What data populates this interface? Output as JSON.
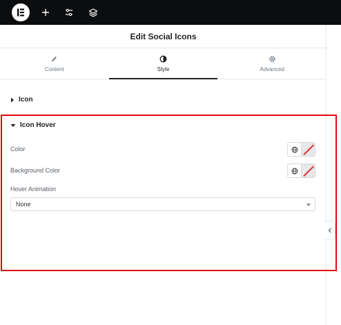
{
  "header": {
    "title": "Edit Social Icons"
  },
  "tabs": [
    {
      "label": "Content",
      "icon": "pencil-icon"
    },
    {
      "label": "Style",
      "icon": "half-circle-icon",
      "active": true
    },
    {
      "label": "Advanced",
      "icon": "gear-icon"
    }
  ],
  "sections": {
    "icon": {
      "label": "Icon",
      "expanded": false
    },
    "icon_hover": {
      "label": "Icon Hover",
      "expanded": true
    }
  },
  "controls": {
    "color": {
      "label": "Color"
    },
    "background_color": {
      "label": "Background Color"
    },
    "hover_animation": {
      "label": "Hover Animation",
      "value": "None"
    }
  },
  "colors": {
    "topbar": "#0c0d0e",
    "highlight": "#e0060c",
    "active_tab": "#1f2124"
  }
}
